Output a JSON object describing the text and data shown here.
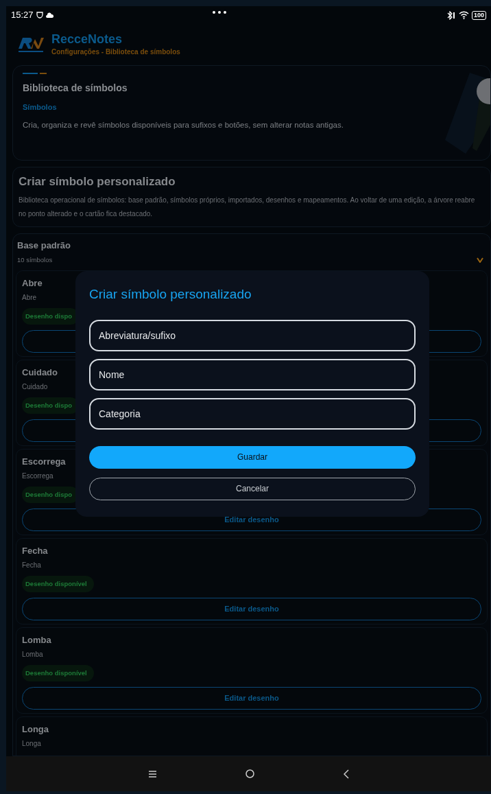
{
  "status_bar": {
    "time": "15:27",
    "battery": "100"
  },
  "app": {
    "name": "RecceNotes",
    "subtitle": "Configurações - Biblioteca de símbolos"
  },
  "intro_card": {
    "title": "Biblioteca de símbolos",
    "tag": "Símbolos",
    "description": "Cria, organiza e revê símbolos disponíveis para sufixos e botões, sem alterar notas antigas."
  },
  "create_card": {
    "title": "Criar símbolo personalizado",
    "description": "Biblioteca operacional de símbolos: base padrão, símbolos próprios, importados, desenhos e mapeamentos. Ao voltar de uma edição, a árvore reabre no ponto alterado e o cartão fica destacado."
  },
  "group": {
    "title": "Base padrão",
    "count": "10 símbolos"
  },
  "symbols": [
    {
      "name": "Abre",
      "subtitle": "Abre",
      "badge": "Desenho dispo"
    },
    {
      "name": "Cuidado",
      "subtitle": "Cuidado",
      "badge": "Desenho dispo"
    },
    {
      "name": "Escorrega",
      "subtitle": "Escorrega",
      "badge": "Desenho dispo",
      "button": "Editar desenho"
    },
    {
      "name": "Fecha",
      "subtitle": "Fecha",
      "badge": "Desenho disponível",
      "button": "Editar desenho"
    },
    {
      "name": "Lomba",
      "subtitle": "Lomba",
      "badge": "Desenho disponível",
      "button": "Editar desenho"
    },
    {
      "name": "Longa",
      "subtitle": "Longa"
    }
  ],
  "dialog": {
    "title": "Criar símbolo personalizado",
    "fields": [
      {
        "placeholder": "Abreviatura/sufixo"
      },
      {
        "placeholder": "Nome"
      },
      {
        "placeholder": "Categoria"
      }
    ],
    "buttons": [
      {
        "label": "Guardar",
        "kind": "primary"
      },
      {
        "label": "Cancelar",
        "kind": "secondary"
      }
    ]
  }
}
